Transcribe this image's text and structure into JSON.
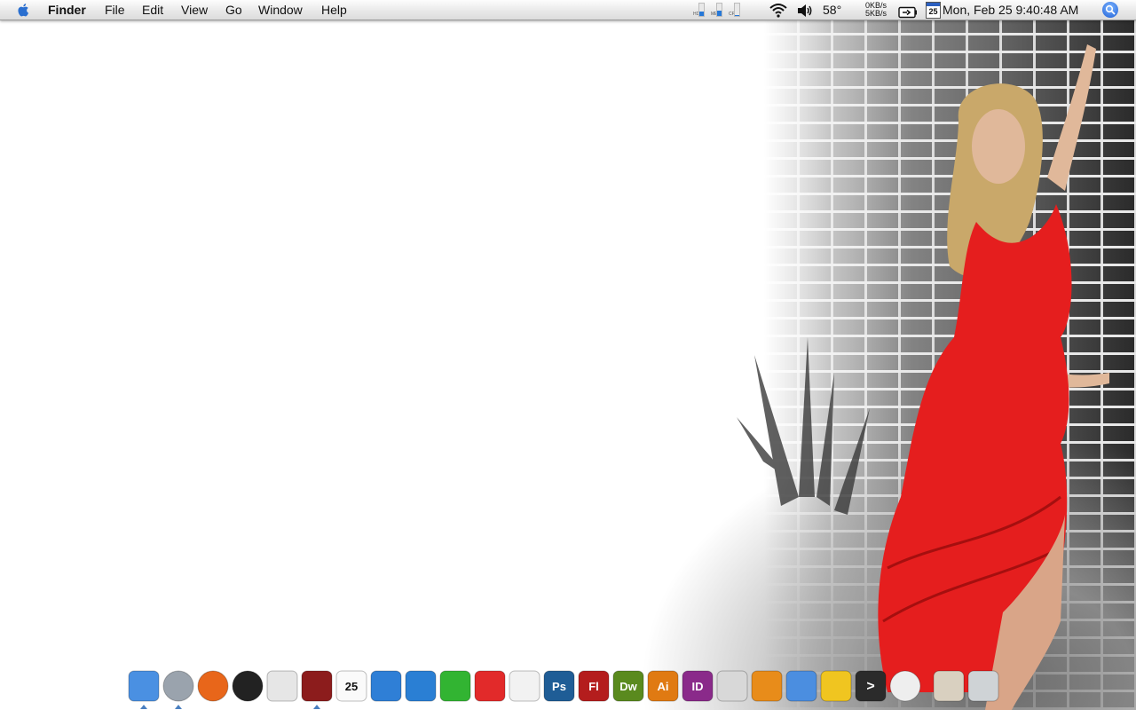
{
  "menubar": {
    "items": [
      "Finder",
      "File",
      "Edit",
      "View",
      "Go",
      "Window",
      "Help"
    ],
    "status": {
      "meters": [
        {
          "label": "HD",
          "fill_pct": 35
        },
        {
          "label": "MEM",
          "fill_pct": 45
        },
        {
          "label": "CPU",
          "fill_pct": 5
        }
      ],
      "temperature": "58°",
      "net_down": "0KB/s",
      "net_up": "5KB/s",
      "calendar_day": "25",
      "clock": "Mon, Feb 25  9:40:48 AM"
    }
  },
  "dock": {
    "items": [
      {
        "name": "finder",
        "label": "",
        "color": "#4a90e2",
        "running": true
      },
      {
        "name": "safari",
        "label": "",
        "color": "#9aa3ad",
        "running": true
      },
      {
        "name": "firefox",
        "label": "",
        "color": "#e8661a",
        "running": false
      },
      {
        "name": "itunes-dvd",
        "label": "",
        "color": "#222222",
        "running": false
      },
      {
        "name": "remote",
        "label": "",
        "color": "#e6e6e6",
        "running": false
      },
      {
        "name": "aperture",
        "label": "",
        "color": "#8c1c1c",
        "running": true
      },
      {
        "name": "ical",
        "label": "25",
        "color": "#c22a2a",
        "running": false
      },
      {
        "name": "globe",
        "label": "",
        "color": "#2f7fd6",
        "running": false
      },
      {
        "name": "w-app",
        "label": "",
        "color": "#2a7fd4",
        "running": false
      },
      {
        "name": "x-app",
        "label": "",
        "color": "#32b432",
        "running": false
      },
      {
        "name": "p-app",
        "label": "",
        "color": "#e22a2a",
        "running": false
      },
      {
        "name": "textedit",
        "label": "",
        "color": "#f2f2f2",
        "running": false
      },
      {
        "name": "photoshop",
        "label": "Ps",
        "color": "#1f5d96",
        "running": false
      },
      {
        "name": "flash",
        "label": "Fl",
        "color": "#b41d1d",
        "running": false
      },
      {
        "name": "dreamweaver",
        "label": "Dw",
        "color": "#5a8a1e",
        "running": false
      },
      {
        "name": "illustrator",
        "label": "Ai",
        "color": "#e07a12",
        "running": false
      },
      {
        "name": "indesign",
        "label": "ID",
        "color": "#8a2a8a",
        "running": false
      },
      {
        "name": "dvd-player",
        "label": "",
        "color": "#d8d8d8",
        "running": false
      },
      {
        "name": "installer",
        "label": "",
        "color": "#e88c1a",
        "running": false
      },
      {
        "name": "xcode",
        "label": "",
        "color": "#4b8ee0",
        "running": false
      },
      {
        "name": "kodak",
        "label": "",
        "color": "#f0c520",
        "running": false
      },
      {
        "name": "terminal",
        "label": ">",
        "color": "#2b2b2b",
        "running": false
      },
      {
        "name": "disk",
        "label": "",
        "color": "#eeeeee",
        "running": false
      },
      {
        "name": "downloads",
        "label": "",
        "color": "#d9d0c0",
        "running": false
      },
      {
        "name": "trash",
        "label": "",
        "color": "#cfd3d6",
        "running": false
      }
    ]
  }
}
